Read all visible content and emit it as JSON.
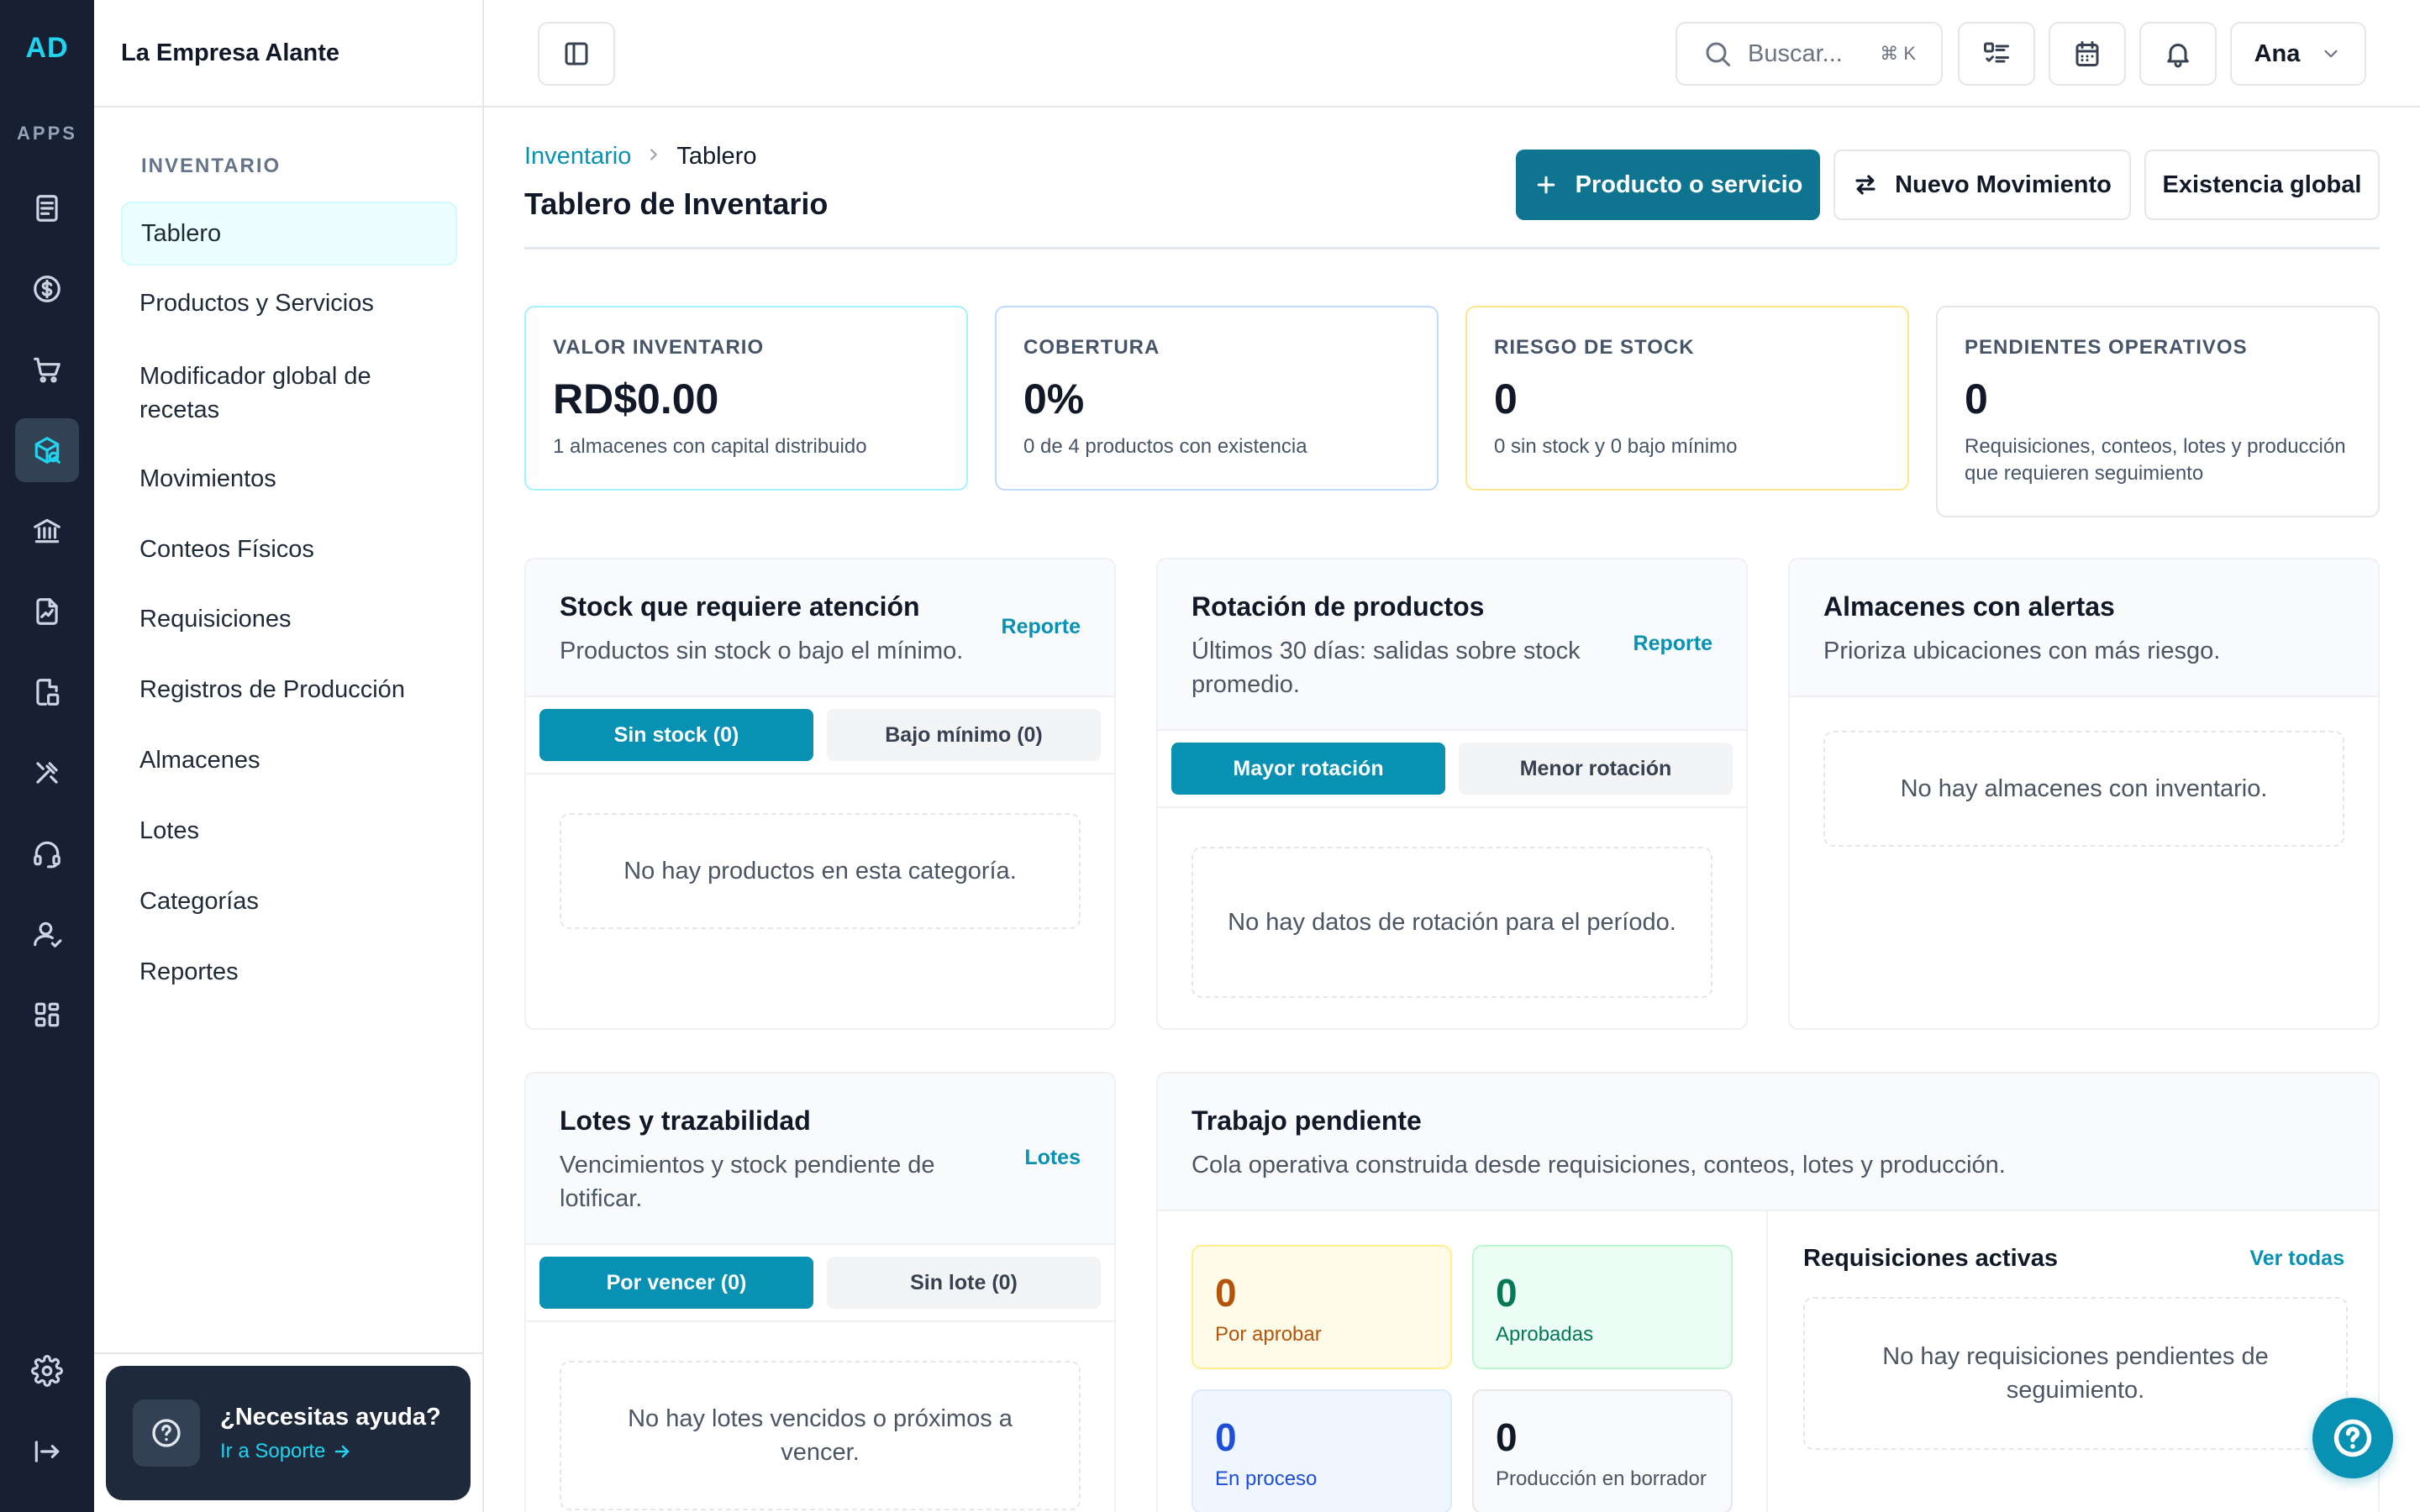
{
  "brand": {
    "initials": "AD",
    "apps_label": "APPS"
  },
  "colors": {
    "accent": "#0891b2",
    "rail_bg": "#172033",
    "primary_button": "#0e7490"
  },
  "rail": {
    "items": [
      "document-icon",
      "dollar-icon",
      "cart-icon",
      "inventory-icon",
      "bank-icon",
      "report-icon",
      "file-icon",
      "tools-icon",
      "headset-icon",
      "user-icon",
      "grid-icon"
    ],
    "active": "inventory-icon",
    "bottom": [
      "settings-icon",
      "logout-icon"
    ]
  },
  "sidebar": {
    "company": "La Empresa Alante",
    "section": "INVENTARIO",
    "items": [
      {
        "label": "Tablero",
        "active": true
      },
      {
        "label": "Productos y Servicios"
      },
      {
        "label": "Modificador global de recetas"
      },
      {
        "label": "Movimientos"
      },
      {
        "label": "Conteos Físicos"
      },
      {
        "label": "Requisiciones"
      },
      {
        "label": "Registros de Producción"
      },
      {
        "label": "Almacenes"
      },
      {
        "label": "Lotes"
      },
      {
        "label": "Categorías"
      },
      {
        "label": "Reportes"
      }
    ],
    "help": {
      "title": "¿Necesitas ayuda?",
      "link": "Ir a Soporte"
    }
  },
  "topbar": {
    "search_placeholder": "Buscar...",
    "search_shortcut": "⌘ K",
    "user_name": "Ana"
  },
  "header": {
    "breadcrumb": [
      "Inventario",
      "Tablero"
    ],
    "title": "Tablero de Inventario",
    "actions": {
      "primary": "Producto o servicio",
      "movement": "Nuevo Movimiento",
      "global_stock": "Existencia global"
    }
  },
  "kpis": [
    {
      "label": "VALOR INVENTARIO",
      "value": "RD$0.00",
      "desc": "1 almacenes con capital distribuido",
      "border": "#a5f3fc"
    },
    {
      "label": "COBERTURA",
      "value": "0%",
      "desc": "0 de 4 productos con existencia",
      "border": "#bfdbfe"
    },
    {
      "label": "RIESGO DE STOCK",
      "value": "0",
      "desc": "0 sin stock y 0 bajo mínimo",
      "border": "#fde68a"
    },
    {
      "label": "PENDIENTES OPERATIVOS",
      "value": "0",
      "desc": "Requisiciones, conteos, lotes y producción que requieren seguimiento",
      "border": "#e5e7eb"
    }
  ],
  "panels": {
    "stock": {
      "title": "Stock que requiere atención",
      "sub": "Productos sin stock o bajo el mínimo.",
      "link": "Reporte",
      "tabs": [
        "Sin stock (0)",
        "Bajo mínimo (0)"
      ],
      "empty": "No hay productos en esta categoría."
    },
    "rotation": {
      "title": "Rotación de productos",
      "sub": "Últimos 30 días: salidas sobre stock promedio.",
      "link": "Reporte",
      "tabs": [
        "Mayor rotación",
        "Menor rotación"
      ],
      "empty": "No hay datos de rotación para el período."
    },
    "warehouses": {
      "title": "Almacenes con alertas",
      "sub": "Prioriza ubicaciones con más riesgo.",
      "empty": "No hay almacenes con inventario."
    },
    "lots": {
      "title": "Lotes y trazabilidad",
      "sub": "Vencimientos y stock pendiente de lotificar.",
      "link": "Lotes",
      "tabs": [
        "Por vencer (0)",
        "Sin lote (0)"
      ],
      "empty": "No hay lotes vencidos o próximos a vencer."
    },
    "work": {
      "title": "Trabajo pendiente",
      "sub": "Cola operativa construida desde requisiciones, conteos, lotes y producción.",
      "stats": [
        {
          "value": "0",
          "label": "Por aprobar"
        },
        {
          "value": "0",
          "label": "Aprobadas"
        },
        {
          "value": "0",
          "label": "En proceso"
        },
        {
          "value": "0",
          "label": "Producción en borrador"
        }
      ],
      "requisitions_title": "Requisiciones activas",
      "requisitions_link": "Ver todas",
      "requisitions_empty": "No hay requisiciones pendientes de seguimiento."
    }
  }
}
